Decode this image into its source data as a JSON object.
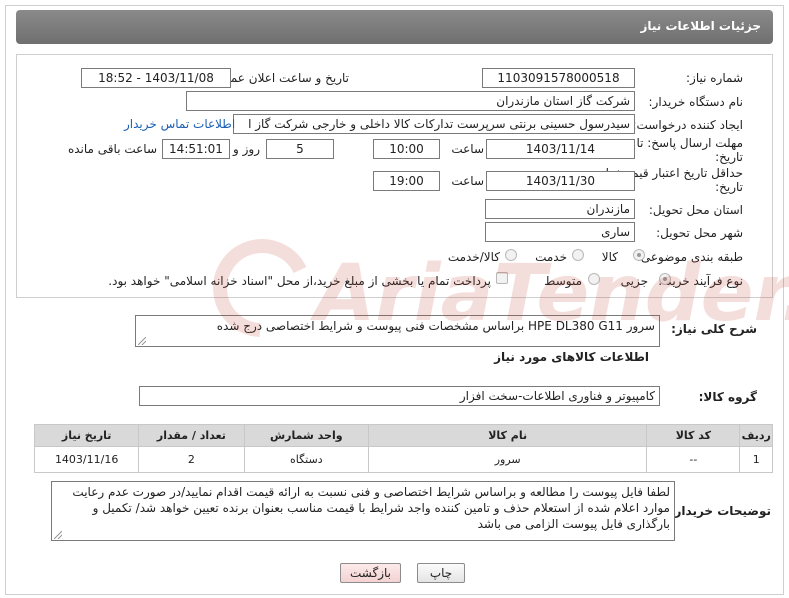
{
  "header": {
    "title": "جزئیات اطلاعات نیاز"
  },
  "form": {
    "need_number_label": "شماره نیاز:",
    "need_number": "1103091578000518",
    "announce_label": "تاریخ و ساعت اعلان عمومی:",
    "announce_value": "1403/11/08 - 18:52",
    "buyer_org_label": "نام دستگاه خریدار:",
    "buyer_org": "شرکت گاز استان مازندران",
    "requester_label": "ایجاد کننده درخواست:",
    "requester": "سیدرسول حسینی برنتی سرپرست تدارکات کالا داخلی و خارجی  شرکت گاز ا",
    "contact_link": "اطلاعات تماس خریدار",
    "send_deadline_label_1": "مهلت ارسال پاسخ: تا",
    "send_deadline_label_2": "تاریخ:",
    "send_date": "1403/11/14",
    "time_label": "ساعت",
    "send_time": "10:00",
    "days_value": "5",
    "days_label": "روز و",
    "remaining_time": "14:51:01",
    "remaining_label": "ساعت باقی مانده",
    "validity_label_1": "حداقل تاریخ اعتبار قیمت: تا",
    "validity_label_2": "تاریخ:",
    "validity_date": "1403/11/30",
    "validity_time": "19:00",
    "province_label": "استان محل تحویل:",
    "province": "مازندران",
    "city_label": "شهر محل تحویل:",
    "city": "ساری",
    "category_label": "طبقه بندی موضوعی:",
    "category_options": [
      "کالا",
      "خدمت",
      "کالا/خدمت"
    ],
    "process_label": "نوع فرآیند خرید :",
    "process_options": [
      "جزیی",
      "متوسط"
    ],
    "payment_text": "پرداخت تمام یا بخشی از مبلغ خرید،از محل \"اسناد خزانه اسلامی\" خواهد بود."
  },
  "description": {
    "label": "شرح کلی نیاز:",
    "value": "سرور  HPE DL380 G11  براساس مشخصات فنی پیوست و شرایط اختصاصی درج شده"
  },
  "items_section": {
    "title": "اطلاعات کالاهای مورد نیاز",
    "group_label": "گروه کالا:",
    "group_value": "کامپیوتر و فناوری اطلاعات-سخت افزار",
    "columns": [
      "ردیف",
      "کد کالا",
      "نام کالا",
      "واحد شمارش",
      "تعداد / مقدار",
      "تاریخ نیاز"
    ],
    "rows": [
      [
        "1",
        "--",
        "سرور",
        "دستگاه",
        "2",
        "1403/11/16"
      ]
    ]
  },
  "buyer_notes": {
    "label": "توضیحات خریدار:",
    "value": "لطفا فایل پیوست را مطالعه و براساس شرایط اختصاصی و فنی نسبت به ارائه قیمت اقدام نمایید/در صورت عدم رعایت موارد اعلام شده از استعلام حذف و تامین کننده واجد شرایط با قیمت مناسب بعنوان برنده تعیین خواهد شد/ تکمیل و بارگذاری فایل پیوست الزامی می باشد"
  },
  "buttons": {
    "print": "چاپ",
    "back": "بازگشت"
  },
  "watermark_text": "AriaTender.neT",
  "colors": {
    "accent": "#1b5fb3",
    "watermark": "#c0392b",
    "back_button": "#f5dada"
  }
}
